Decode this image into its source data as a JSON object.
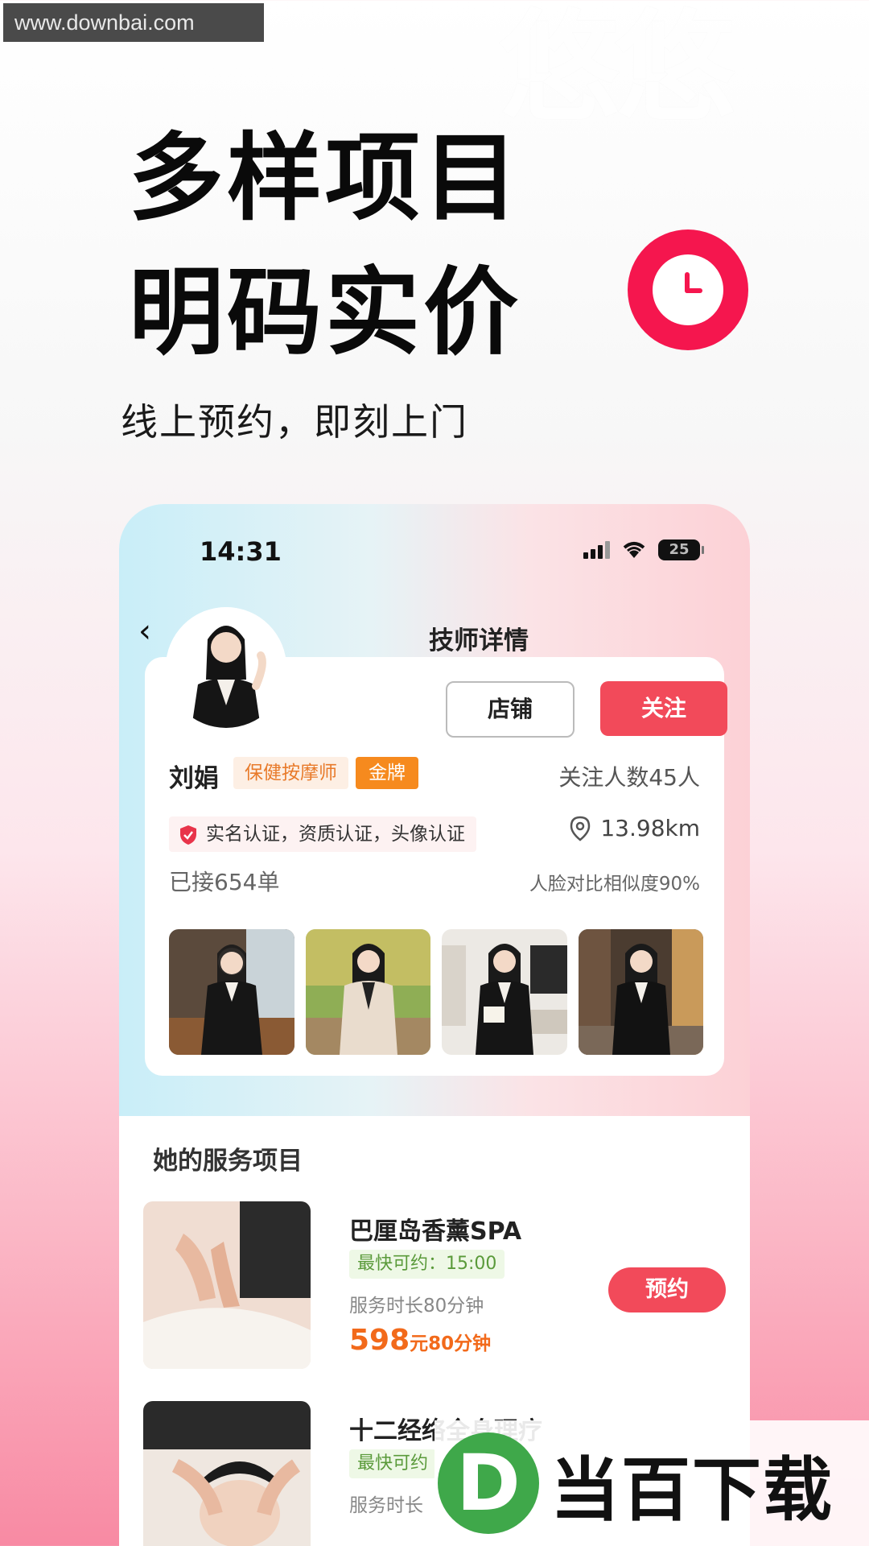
{
  "watermark_top": "www.downbai.com",
  "brand_logo": "悠悠",
  "headline": {
    "line1": "多样项目",
    "line2": "明码实价"
  },
  "subtitle": "线上预约，即刻上门",
  "status_bar": {
    "time": "14:31",
    "battery": "25"
  },
  "nav": {
    "back_glyph": "‹",
    "title": "技师详情"
  },
  "profile": {
    "shop_button": "店铺",
    "follow_button": "关注",
    "name": "刘娟",
    "role_tag": "保健按摩师",
    "level_tag": "金牌",
    "followers": "关注人数45人",
    "certifications": "实名认证，资质认证，头像认证",
    "distance": "13.98km",
    "orders": "已接654单",
    "face_similarity": "人脸对比相似度90%"
  },
  "services_section_title": "她的服务项目",
  "services": [
    {
      "name": "巴厘岛香薰SPA",
      "available": "最快可约：15:00",
      "duration": "服务时长80分钟",
      "price": "598",
      "price_unit": "元80分钟",
      "book_label": "预约"
    },
    {
      "name": "十二经络全身理疗",
      "available": "最快可约",
      "duration": "服务时长",
      "price": "",
      "price_unit": "",
      "book_label": "预约"
    }
  ],
  "download_badge": {
    "logo_letter": "D",
    "text": "当百下载"
  },
  "colors": {
    "accent_red": "#f24a5a",
    "clock_red": "#f5164e",
    "price_orange": "#f26a1b",
    "gold_tag": "#f68a1e"
  }
}
